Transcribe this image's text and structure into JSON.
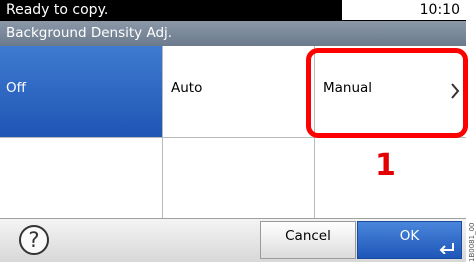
{
  "status": {
    "message": "Ready to copy.",
    "time": "10:10"
  },
  "title": "Background Density Adj.",
  "options": [
    {
      "label": "Off",
      "selected": true
    },
    {
      "label": "Auto",
      "selected": false
    },
    {
      "label": "Manual",
      "selected": false,
      "icon": "chevron-right-icon"
    }
  ],
  "callout": {
    "number": "1",
    "color": "#ff0000"
  },
  "footer": {
    "help_icon": "help-icon",
    "help_glyph": "?",
    "cancel_label": "Cancel",
    "ok_label": "OK",
    "ok_icon": "enter-icon"
  },
  "figure_code": "1B0081_00",
  "colors": {
    "selected": "#2a63c2",
    "status_bar": "#000000",
    "title_bar": "#7b899a",
    "callout": "#ff0000"
  }
}
